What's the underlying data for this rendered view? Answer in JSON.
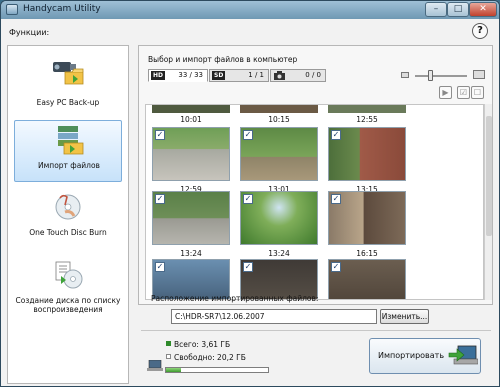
{
  "window": {
    "title": "Handycam Utility",
    "controls": {
      "minimize": "–",
      "maximize": "□",
      "close": "✕"
    }
  },
  "help": {
    "label": "?"
  },
  "sidebar": {
    "heading": "Функции:",
    "items": [
      {
        "label": "Easy PC Back-up",
        "icon": "camcorder-folder-icon",
        "selected": false
      },
      {
        "label": "Импорт файлов",
        "icon": "import-files-icon",
        "selected": true
      },
      {
        "label": "One Touch Disc Burn",
        "icon": "disc-touch-icon",
        "selected": false
      },
      {
        "label": "Создание диска по списку воспроизведения",
        "icon": "playlist-disc-icon",
        "selected": false
      }
    ]
  },
  "import_panel": {
    "title": "Выбор и импорт файлов в компьютер",
    "tabs": [
      {
        "badge": "HD",
        "count": "33 / 33",
        "icon": "hd-icon"
      },
      {
        "badge": "SD",
        "count": "1 / 1",
        "icon": "sd-icon"
      },
      {
        "badge": "",
        "count": "0 / 0",
        "icon": "camera-icon"
      }
    ],
    "rows": [
      {
        "times": [
          "10:01",
          "10:15",
          "12:55"
        ]
      },
      {
        "times": [
          "12:59",
          "13:01",
          "13:15"
        ]
      },
      {
        "times": [
          "13:24",
          "13:24",
          "16:15"
        ]
      }
    ],
    "check_mark": "✓",
    "colors": {
      "thumb_a": "#4a6b3a",
      "thumb_b": "#5d7f44",
      "thumb_c": "#7a6a56"
    }
  },
  "location": {
    "label": "Расположение импортированных файлов:",
    "path": "C:\\HDR-SR7\\12.06.2007",
    "change_label": "Изменить..."
  },
  "storage": {
    "total": "Всего: 3,61 ГБ",
    "free": "Свободно: 20,2 ГБ",
    "used_fraction": 0.15
  },
  "import_button": {
    "label": "Импортировать"
  }
}
